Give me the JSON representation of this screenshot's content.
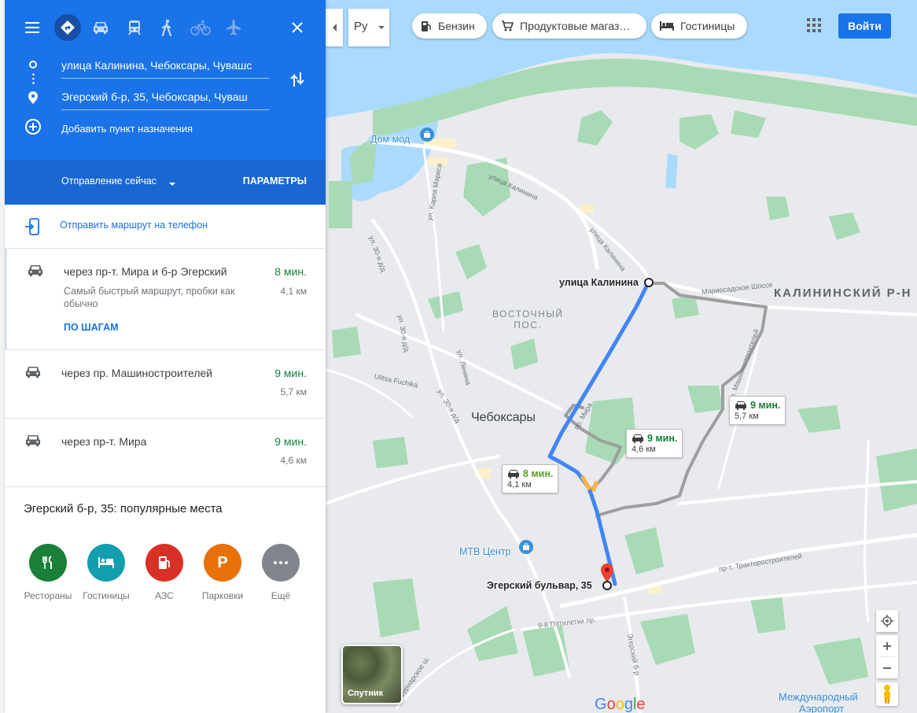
{
  "panel": {
    "travel_modes": [
      "menu-icon",
      "best-route-icon",
      "car-icon",
      "transit-icon",
      "walk-icon",
      "bike-icon",
      "flight-icon",
      "close-icon"
    ],
    "origin": "улица Калинина, Чебоксары, Чувашс",
    "destination": "Эгерский б-р, 35, Чебоксары, Чуваш",
    "add_destination": "Добавить пункт назначения",
    "departure": "Отправление сейчас",
    "options": "ПАРАМЕТРЫ",
    "send_to_phone": "Отправить маршрут на телефон",
    "routes": [
      {
        "via": "через пр-т. Мира и б-р Эгерский",
        "time": "8 мин.",
        "distance": "4,1 км",
        "note": "Самый быстрый маршрут, пробки как обычно",
        "steps": "ПО ШАГАМ"
      },
      {
        "via": "через пр. Машиностроителей",
        "time": "9 мин.",
        "distance": "5,7 км"
      },
      {
        "via": "через пр-т. Мира",
        "time": "9 мин.",
        "distance": "4,6 км"
      }
    ],
    "popular_title": "Эгерский б-р, 35: популярные места",
    "categories": [
      {
        "label": "Рестораны",
        "color": "#188038",
        "icon": "fork-knife-icon"
      },
      {
        "label": "Гостиницы",
        "color": "#129eaf",
        "icon": "bed-icon"
      },
      {
        "label": "АЗС",
        "color": "#d93025",
        "icon": "gas-pump-icon"
      },
      {
        "label": "Парковки",
        "color": "#e8710a",
        "icon": "parking-icon"
      },
      {
        "label": "Ещё",
        "color": "#80868b",
        "icon": "more-icon"
      }
    ]
  },
  "map": {
    "lang": "Ру",
    "chips": [
      "Бензин",
      "Продуктовые магаз…",
      "Гостиницы"
    ],
    "signin": "Войти",
    "origin_label": "улица Калинина",
    "destination_label": "Эгерский бульвар, 35",
    "city": "Чебоксары",
    "district_1": "ВОСТОЧНЫЙ",
    "district_1b": "ПОС.",
    "district_2": "КАЛИНИНСКИЙ Р-Н",
    "poi_1": "Дом мод",
    "poi_2": "МТВ Центр",
    "airport": "Международный",
    "airport_2": "Аэропорт",
    "satellite": "Спутник",
    "route_cards": [
      {
        "time": "8 мин.",
        "distance": "4,1 км"
      },
      {
        "time": "9 мин.",
        "distance": "4,6 км"
      },
      {
        "time": "9 мин.",
        "distance": "5,7 км"
      }
    ],
    "road_labels": [
      "улица Калинина",
      "ул. Карла Маркса",
      "улица Калинина",
      "ул. 30-я д/д",
      "ул. 30-я д/д",
      "ул. Ленина",
      "Ulitsa Fuchika",
      "ул. 30-я д/д",
      "Мариосадское Шоссе",
      "пр. Машиностроителей",
      "пр. Мира",
      "пр-т. Тракторостроителей",
      "9-й Пятилетки пр.",
      "Эгерский б-р",
      "Вурнарское ш."
    ],
    "colors": {
      "route_active": "#4285f4",
      "route_alt": "#9e9e9e",
      "water": "#aadaff",
      "park": "#a8dab5",
      "land": "#e8eaed"
    }
  }
}
